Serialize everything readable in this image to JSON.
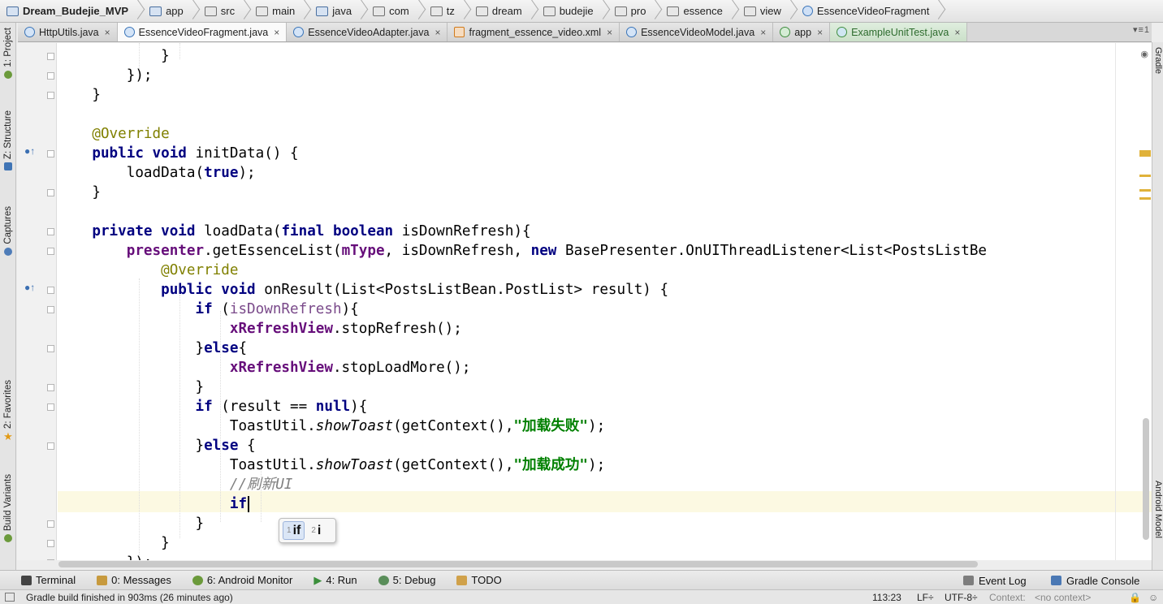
{
  "breadcrumbs": [
    "Dream_Budejie_MVP",
    "app",
    "src",
    "main",
    "java",
    "com",
    "tz",
    "dream",
    "budejie",
    "pro",
    "essence",
    "view",
    "EssenceVideoFragment"
  ],
  "tabs": [
    {
      "label": "HttpUtils.java",
      "icon": "java-class-icon"
    },
    {
      "label": "EssenceVideoFragment.java",
      "icon": "java-class-icon",
      "active": true
    },
    {
      "label": "EssenceVideoAdapter.java",
      "icon": "java-class-icon"
    },
    {
      "label": "fragment_essence_video.xml",
      "icon": "xml-file-icon"
    },
    {
      "label": "EssenceVideoModel.java",
      "icon": "java-class-icon"
    },
    {
      "label": "app",
      "icon": "gradle-module-icon"
    },
    {
      "label": "ExampleUnitTest.java",
      "icon": "test-class-icon"
    }
  ],
  "tabs_overflow": "▾≡1",
  "left_tools": {
    "project": "1: Project",
    "structure": "Z: Structure",
    "captures": "Captures",
    "favorites": "2: Favorites",
    "build_variants": "Build Variants"
  },
  "right_tools": {
    "gradle": "Gradle",
    "android_model": "Android Model"
  },
  "code_lines": [
    "            }",
    "        });",
    "    }",
    "",
    "    @Override",
    "    public void initData() {",
    "        loadData(true);",
    "    }",
    "",
    "    private void loadData(final boolean isDownRefresh){",
    "        presenter.getEssenceList(mType, isDownRefresh, new BasePresenter.OnUIThreadListener<List<PostsListBe",
    "            @Override",
    "            public void onResult(List<PostsListBean.PostList> result) {",
    "                if (isDownRefresh){",
    "                    xRefreshView.stopRefresh();",
    "                }else{",
    "                    xRefreshView.stopLoadMore();",
    "                }",
    "                if (result == null){",
    "                    ToastUtil.showToast(getContext(),\"加载失败\");",
    "                }else {",
    "                    ToastUtil.showToast(getContext(),\"加载成功\");",
    "                    //刷新UI",
    "                    if",
    "                }",
    "            }",
    "        });"
  ],
  "autocomplete": [
    {
      "num": "1",
      "label": "if",
      "selected": true
    },
    {
      "num": "2",
      "label": "i",
      "selected": false
    }
  ],
  "bottom_tools": {
    "terminal": "Terminal",
    "messages": "0: Messages",
    "android_monitor": "6: Android Monitor",
    "run": "4: Run",
    "debug": "5: Debug",
    "todo": "TODO",
    "event_log": "Event Log",
    "gradle_console": "Gradle Console"
  },
  "status": {
    "message": "Gradle build finished in 903ms (26 minutes ago)",
    "position": "113:23",
    "line_separator": "LF÷",
    "encoding": "UTF-8÷",
    "context_label": "Context:",
    "context_value": "<no context>"
  },
  "colors": {
    "keyword": "#000080",
    "annotation": "#808000",
    "field": "#660e7a",
    "string": "#008000",
    "comment": "#808080",
    "current_line": "#fcf9e2"
  }
}
